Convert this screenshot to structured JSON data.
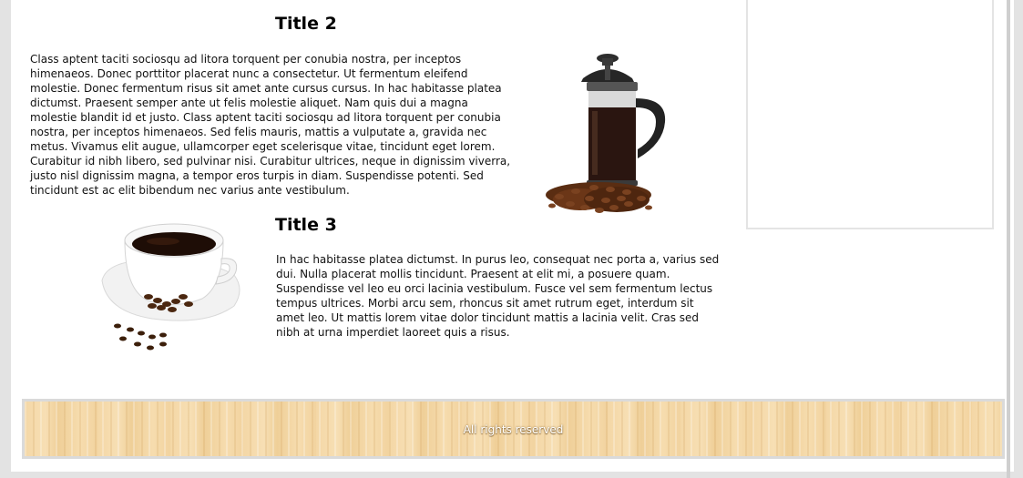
{
  "section2": {
    "title": "Title 2",
    "body": "Class aptent taciti sociosqu ad litora torquent per conubia nostra, per inceptos himenaeos. Donec porttitor placerat nunc a consectetur. Ut fermentum eleifend molestie. Donec fermentum risus sit amet ante cursus cursus. In hac habitasse platea dictumst. Praesent semper ante ut felis molestie aliquet. Nam quis dui a magna molestie blandit id et justo. Class aptent taciti sociosqu ad litora torquent per conubia nostra, per inceptos himenaeos. Sed felis mauris, mattis a vulputate a, gravida nec metus. Vivamus elit augue, ullamcorper eget scelerisque vitae, tincidunt eget lorem. Curabitur id nibh libero, sed pulvinar nisi. Curabitur ultrices, neque in dignissim viverra, justo nisl dignissim magna, a tempor eros turpis in diam. Suspendisse potenti. Sed tincidunt est ac elit bibendum nec varius ante vestibulum.",
    "image": "french-press-coffee-image"
  },
  "section3": {
    "title": "Title 3",
    "body": "In hac habitasse platea dictumst. In purus leo, consequat nec porta a, varius sed dui. Nulla placerat mollis tincidunt. Praesent at elit mi, a posuere quam. Suspendisse vel leo eu orci lacinia vestibulum. Fusce vel sem fermentum lectus tempus ultrices. Morbi arcu sem, rhoncus sit amet rutrum eget, interdum sit amet leo. Ut mattis lorem vitae dolor tincidunt mattis a lacinia velit. Cras sed nibh at urna imperdiet laoreet quis a risus.",
    "image": "coffee-cup-image"
  },
  "footer": {
    "text": "All rights reserved"
  },
  "colors": {
    "page_background": "#e3e3e3",
    "content_background": "#ffffff",
    "footer_wood": "#f4d7a6"
  }
}
